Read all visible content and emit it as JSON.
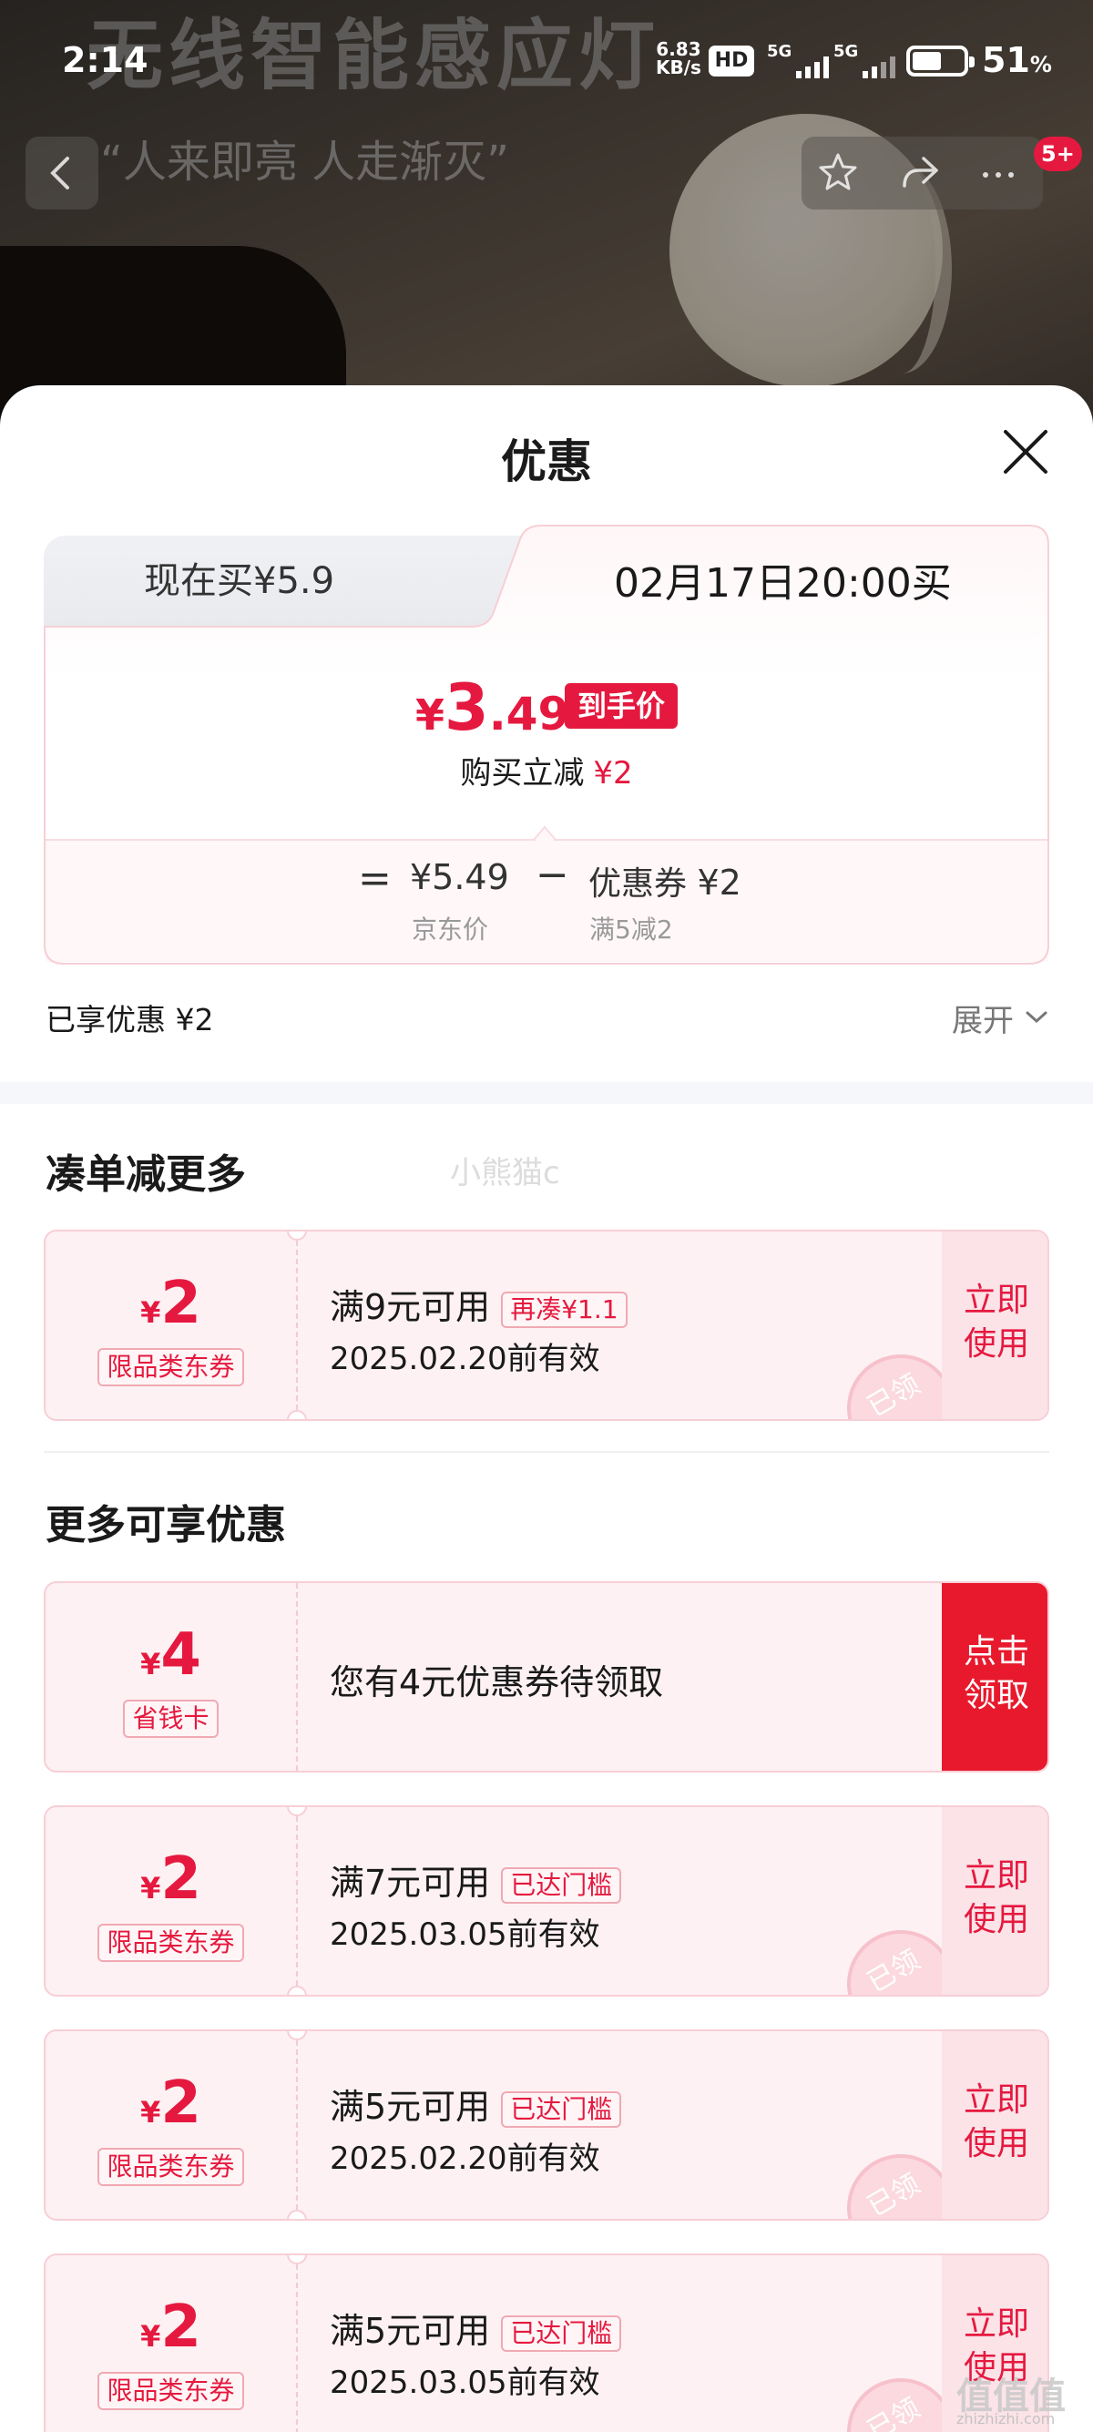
{
  "status_bar": {
    "time": "2:14",
    "net_speed_value": "6.83",
    "net_speed_unit": "KB/s",
    "hd_label": "HD",
    "sim1_label": "5G",
    "sim2_label": "5G",
    "battery_level": 0.51,
    "battery_value": "51",
    "battery_unit": "%"
  },
  "background": {
    "product_title": "无线智能感应灯",
    "product_slogan": "“人来即亮 人走渐灭”",
    "message_badge": "5+"
  },
  "sheet": {
    "title": "优惠",
    "tab_now": "现在买¥5.9",
    "tab_later": "02月17日20:00买",
    "final_price_currency": "¥",
    "final_price_int": "3",
    "final_price_dec": ".49",
    "final_price_tag": "到手价",
    "instant_cut_label": "购买立减",
    "instant_cut_value": "¥2",
    "formula": {
      "equals": "=",
      "jd_price": "¥5.49",
      "jd_price_label": "京东价",
      "minus": "−",
      "coupon_label": "优惠券",
      "coupon_value": "¥2",
      "coupon_rule": "满5减2"
    },
    "enjoyed": "已享优惠 ¥2",
    "expand": "展开"
  },
  "section_bundle": {
    "title": "凑单减更多",
    "watermark": "小熊猫c"
  },
  "section_more": {
    "title": "更多可享优惠"
  },
  "coupons": [
    {
      "currency": "¥",
      "amount": "2",
      "type": "限品类东券",
      "condition": "满9元可用",
      "tag": "再凑¥1.1",
      "expiry": "2025.02.20前有效",
      "action_line1": "立即",
      "action_line2": "使用",
      "stamp": "已领"
    },
    {
      "currency": "¥",
      "amount": "4",
      "type": "省钱卡",
      "message": "您有4元优惠券待领取",
      "action_line1": "点击",
      "action_line2": "领取"
    },
    {
      "currency": "¥",
      "amount": "2",
      "type": "限品类东券",
      "condition": "满7元可用",
      "tag": "已达门槛",
      "expiry": "2025.03.05前有效",
      "action_line1": "立即",
      "action_line2": "使用",
      "stamp": "已领"
    },
    {
      "currency": "¥",
      "amount": "2",
      "type": "限品类东券",
      "condition": "满5元可用",
      "tag": "已达门槛",
      "expiry": "2025.02.20前有效",
      "action_line1": "立即",
      "action_line2": "使用",
      "stamp": "已领"
    },
    {
      "currency": "¥",
      "amount": "2",
      "type": "限品类东券",
      "condition": "满5元可用",
      "tag": "已达门槛",
      "expiry": "2025.03.05前有效",
      "action_line1": "立即",
      "action_line2": "使用",
      "stamp": "已领"
    }
  ],
  "site_watermark": {
    "main": "值值值",
    "sub": "zhizhizhi.com"
  },
  "colors": {
    "accent_red": "#e5193f",
    "coupon_bg": "#fdf1f3",
    "divider": "#f6f7fa"
  }
}
